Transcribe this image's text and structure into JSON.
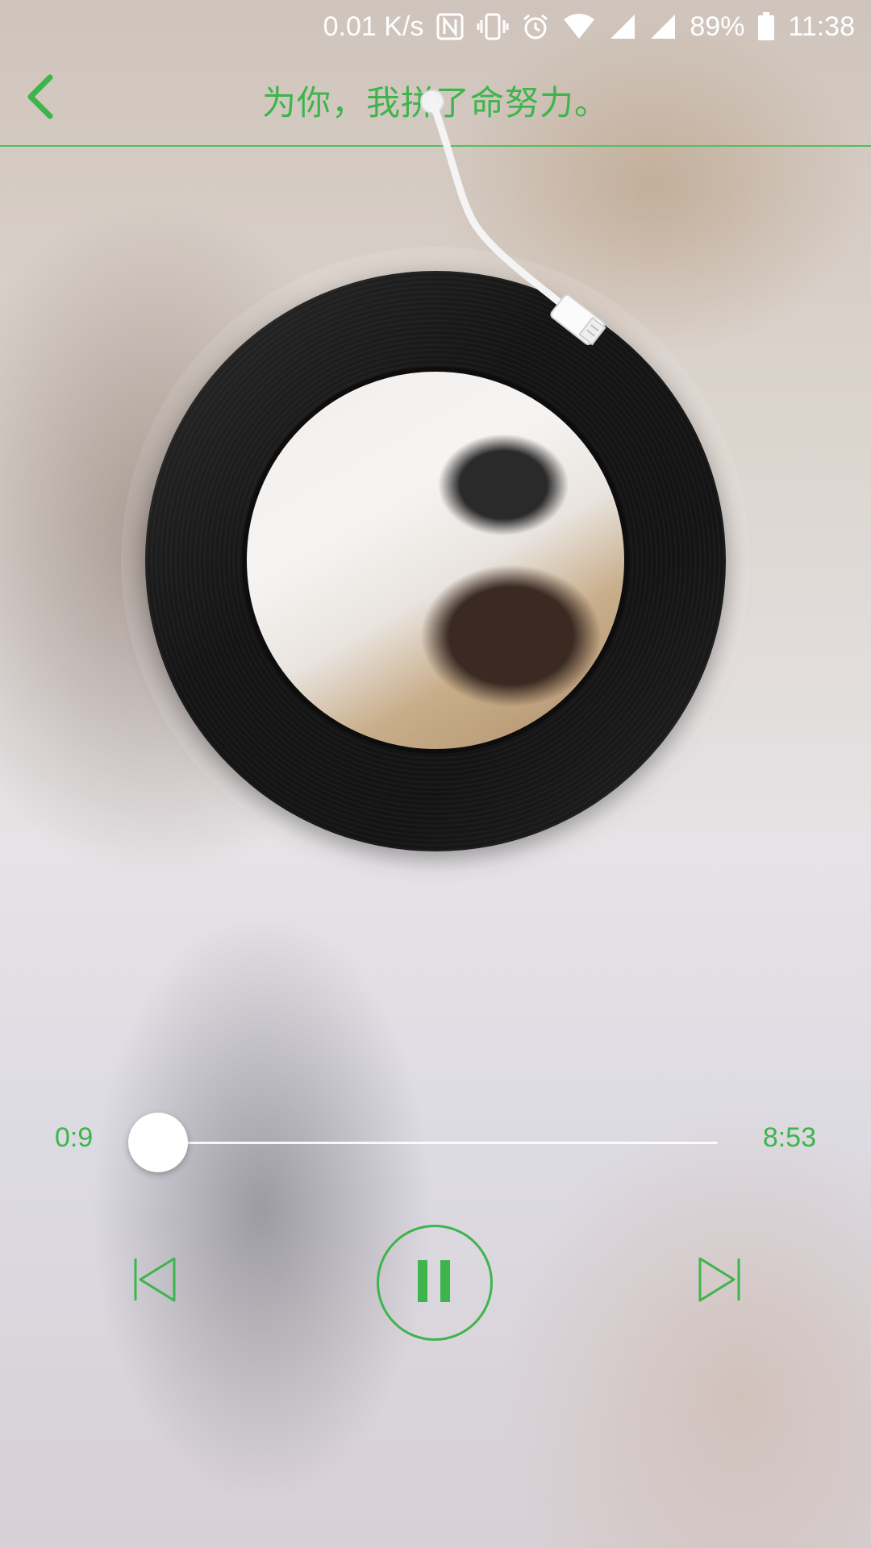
{
  "status_bar": {
    "network_speed": "0.01 K/s",
    "battery_percent": "89%",
    "time": "11:38",
    "icons": [
      "nfc-icon",
      "vibrate-icon",
      "alarm-icon",
      "wifi-icon",
      "signal-icon",
      "signal-icon-2",
      "battery-icon"
    ]
  },
  "header": {
    "title": "为你，我拼了命努力。"
  },
  "player": {
    "current_time": "0:9",
    "total_time": "8:53",
    "progress": 0.017,
    "state": "playing"
  },
  "colors": {
    "accent": "#3db54c",
    "status_text": "#ffffff"
  }
}
